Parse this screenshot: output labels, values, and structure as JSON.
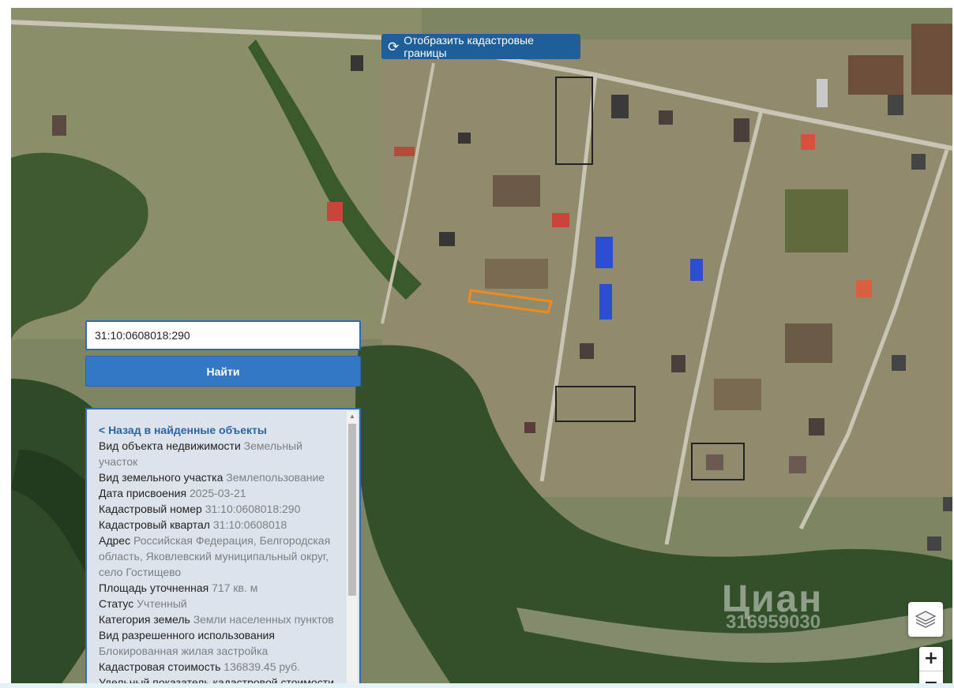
{
  "map": {
    "cadastral_button_label": "Отобразить кадастровые границы",
    "cadastral_icon": "refresh-icon",
    "watermark_brand": "Циан",
    "watermark_id": "316959030",
    "layers_icon": "layers-icon",
    "zoom_in": "+",
    "zoom_out": "−",
    "highlight_color": "#f08a1c"
  },
  "search": {
    "input_value": "31:10:0608018:290",
    "button_label": "Найти"
  },
  "info": {
    "back_link": "< Назад в найденные объекты",
    "rows": [
      {
        "label": "Вид объекта недвижимости",
        "value": "Земельный участок"
      },
      {
        "label": "Вид земельного участка",
        "value": "Землепользование"
      },
      {
        "label": "Дата присвоения",
        "value": "2025-03-21"
      },
      {
        "label": "Кадастровый номер",
        "value": "31:10:0608018:290"
      },
      {
        "label": "Кадастровый квартал",
        "value": "31:10:0608018"
      },
      {
        "label": "Адрес",
        "value": "Российская Федерация, Белгородская область, Яковлевский муниципальный округ, село Гостищево"
      },
      {
        "label": "Площадь уточненная",
        "value": "717 кв. м"
      },
      {
        "label": "Статус",
        "value": "Учтенный"
      },
      {
        "label": "Категория земель",
        "value": "Земли населенных пунктов"
      },
      {
        "label": "Вид разрешенного использования",
        "value": "Блокированная жилая застройка"
      },
      {
        "label": "Кадастровая стоимость",
        "value": "136839.45 руб."
      },
      {
        "label": "Удельный показатель кадастровой стоимости",
        "value": ""
      }
    ]
  }
}
